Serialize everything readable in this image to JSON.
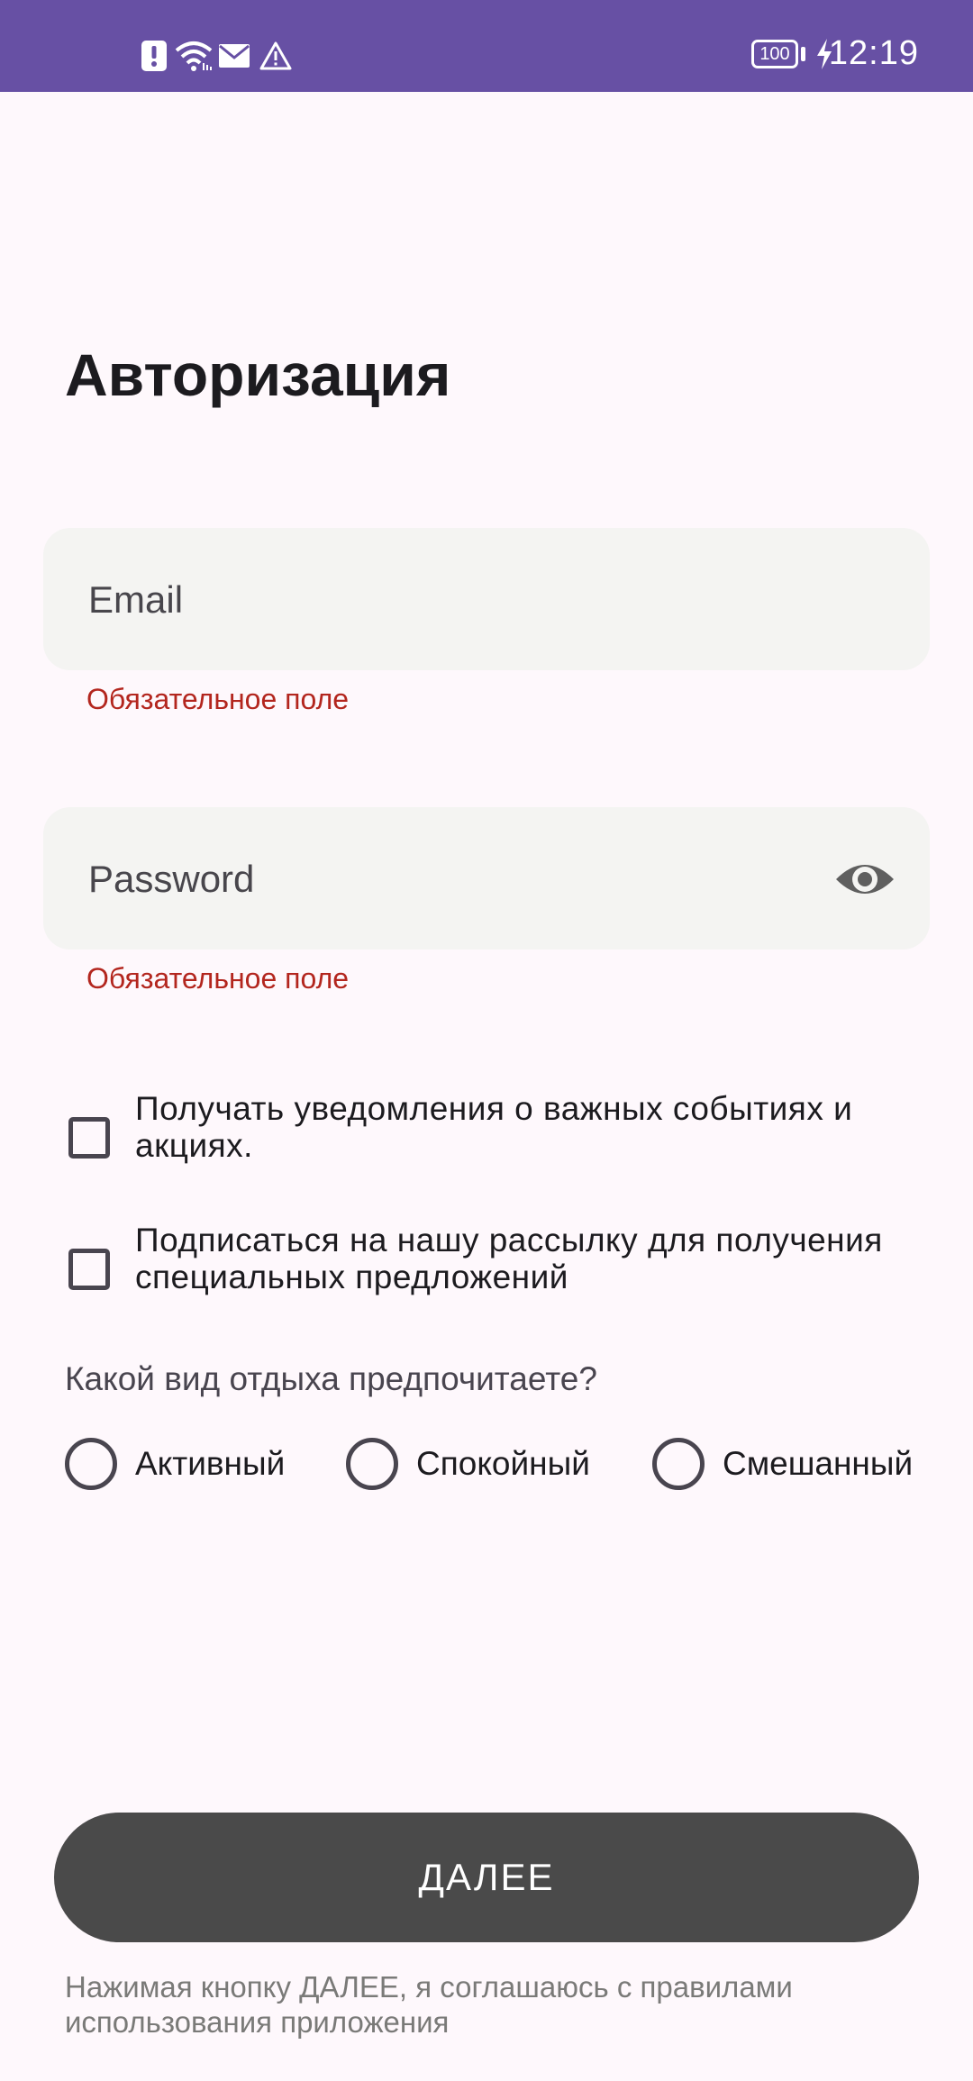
{
  "status_bar": {
    "time": "12:19",
    "battery_level": "100",
    "icons": [
      "alert-icon",
      "wifi-icon",
      "mail-icon",
      "warning-icon",
      "battery-icon",
      "charging-icon"
    ],
    "background": "#6750A4"
  },
  "title": "Авторизация",
  "email": {
    "placeholder": "Email",
    "value": "",
    "error": "Обязательное поле"
  },
  "password": {
    "placeholder": "Password",
    "value": "",
    "error": "Обязательное поле",
    "toggle_icon": "eye-icon"
  },
  "checkboxes": [
    {
      "label": "Получать уведомления о важных событиях и акциях.",
      "checked": false
    },
    {
      "label": "Подписаться на нашу рассылку для получения специальных предложений",
      "checked": false
    }
  ],
  "question": "Какой вид отдыха предпочитаете?",
  "radios": [
    {
      "label": "Активный",
      "selected": false
    },
    {
      "label": "Спокойный",
      "selected": false
    },
    {
      "label": "Смешанный",
      "selected": false
    }
  ],
  "next_button": {
    "label": "ДАЛЕЕ",
    "color": "#4A4A4A"
  },
  "terms": "Нажимая кнопку ДАЛЕЕ, я соглашаюсь с правилами использования приложения",
  "colors": {
    "error": "#B3261E",
    "field_background": "#F4F4F2",
    "page_background": "#FEF8FC"
  }
}
